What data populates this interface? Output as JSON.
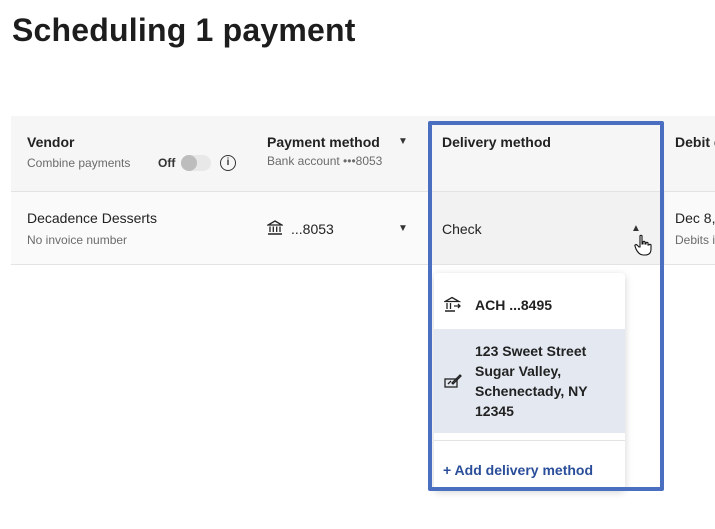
{
  "page": {
    "title": "Scheduling 1 payment"
  },
  "columns": {
    "vendor": {
      "label": "Vendor",
      "sublabel": "Combine payments",
      "toggle_label": "Off"
    },
    "payment_method": {
      "label": "Payment method",
      "sublabel": "Bank account •••8053"
    },
    "delivery_method": {
      "label": "Delivery method"
    },
    "debit": {
      "label": "Debit d"
    }
  },
  "row": {
    "vendor_name": "Decadence Desserts",
    "vendor_sub": "No invoice number",
    "payment_value": "...8053",
    "delivery_value": "Check",
    "debit_value": "Dec 8,",
    "debit_sub": "Debits i"
  },
  "dropdown": {
    "options": [
      {
        "label": "ACH ...8495",
        "icon": "bank-transfer-icon"
      },
      {
        "label": "123 Sweet Street Sugar Valley, Schenectady, NY 12345",
        "icon": "check-mail-icon"
      }
    ],
    "add_label": "+ Add delivery method"
  },
  "colors": {
    "accent": "#2a4e9a",
    "highlight_border": "#4a6fc0",
    "selected_bg": "#e3e8f1"
  }
}
